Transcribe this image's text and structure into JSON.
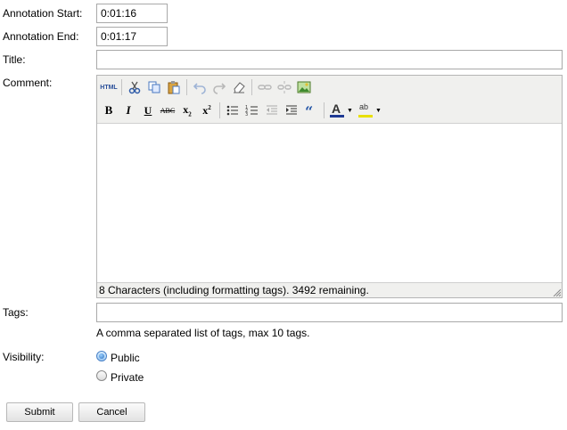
{
  "form": {
    "start_label": "Annotation Start:",
    "start_value": "0:01:16",
    "end_label": "Annotation End:",
    "end_value": "0:01:17",
    "title_label": "Title:",
    "title_value": "",
    "comment_label": "Comment:",
    "tags_label": "Tags:",
    "tags_value": "",
    "tags_hint": "A comma separated list of tags, max 10 tags.",
    "visibility_label": "Visibility:",
    "visibility_options": [
      "Public",
      "Private"
    ],
    "visibility_selected": "Public",
    "submit_label": "Submit",
    "cancel_label": "Cancel"
  },
  "editor": {
    "html_label": "HTML",
    "bold": "B",
    "italic": "I",
    "underline": "U",
    "strike": "ABC",
    "sub": "x",
    "sup": "x",
    "status": "8 Characters (including formatting tags). 3492 remaining.",
    "text_color": "A",
    "highlight_label": "ab"
  },
  "icons": [
    "cut-icon",
    "copy-icon",
    "paste-icon",
    "undo-icon",
    "redo-icon",
    "eraser-icon",
    "link-icon",
    "unlink-icon",
    "image-icon",
    "bullet-list-icon",
    "numbered-list-icon",
    "outdent-icon",
    "indent-icon",
    "blockquote-icon",
    "text-color-icon",
    "highlight-icon",
    "chevron-down-icon",
    "resize-grip-icon"
  ],
  "colors": {
    "text_color_bar": "#1f3a93",
    "highlight_bar": "#e8e000",
    "radio_selected": "#2a6ebf"
  }
}
